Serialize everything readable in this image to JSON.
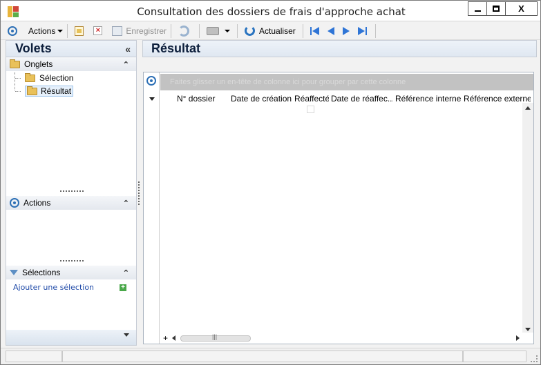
{
  "window": {
    "title": "Consultation des dossiers de frais d'approche achat",
    "minimize_label": "",
    "close_label": "X"
  },
  "toolbar": {
    "actions_label": "Actions",
    "save_label": "Enregistrer",
    "refresh_label": "Actualiser"
  },
  "left_pane": {
    "title": "Volets",
    "collapse_glyph": "«",
    "expand_glyph": "«",
    "tabs_section": {
      "title": "Onglets",
      "items": [
        {
          "label": "Sélection",
          "selected": false
        },
        {
          "label": "Résultat",
          "selected": true
        }
      ]
    },
    "actions_section": {
      "title": "Actions"
    },
    "selections_section": {
      "title": "Sélections",
      "add_link": "Ajouter une sélection"
    }
  },
  "main": {
    "title": "Résultat",
    "grid": {
      "group_band_text": "Faites glisser un en-tête de colonne ici pour grouper par cette colonne",
      "columns": [
        "N° dossier",
        "Date de création",
        "Réaffecté",
        "Date de réaffec...",
        "Référence interne",
        "Référence externe"
      ],
      "rows": []
    }
  },
  "icons": {
    "app": "app-logo-icon",
    "actions": "target-icon",
    "new": "new-document-icon",
    "delete": "delete-icon",
    "save": "save-icon",
    "refresh_disabled": "sync-icon",
    "print": "printer-icon",
    "refresh": "refresh-icon",
    "first": "first-page-icon",
    "previous": "previous-page-icon",
    "next": "next-page-icon",
    "last": "last-page-icon"
  },
  "colors": {
    "accent": "#2c6fb5",
    "nav_arrows": "#2f75d6",
    "pane_title": "#0d1f3c",
    "link": "#1f4aa8"
  }
}
